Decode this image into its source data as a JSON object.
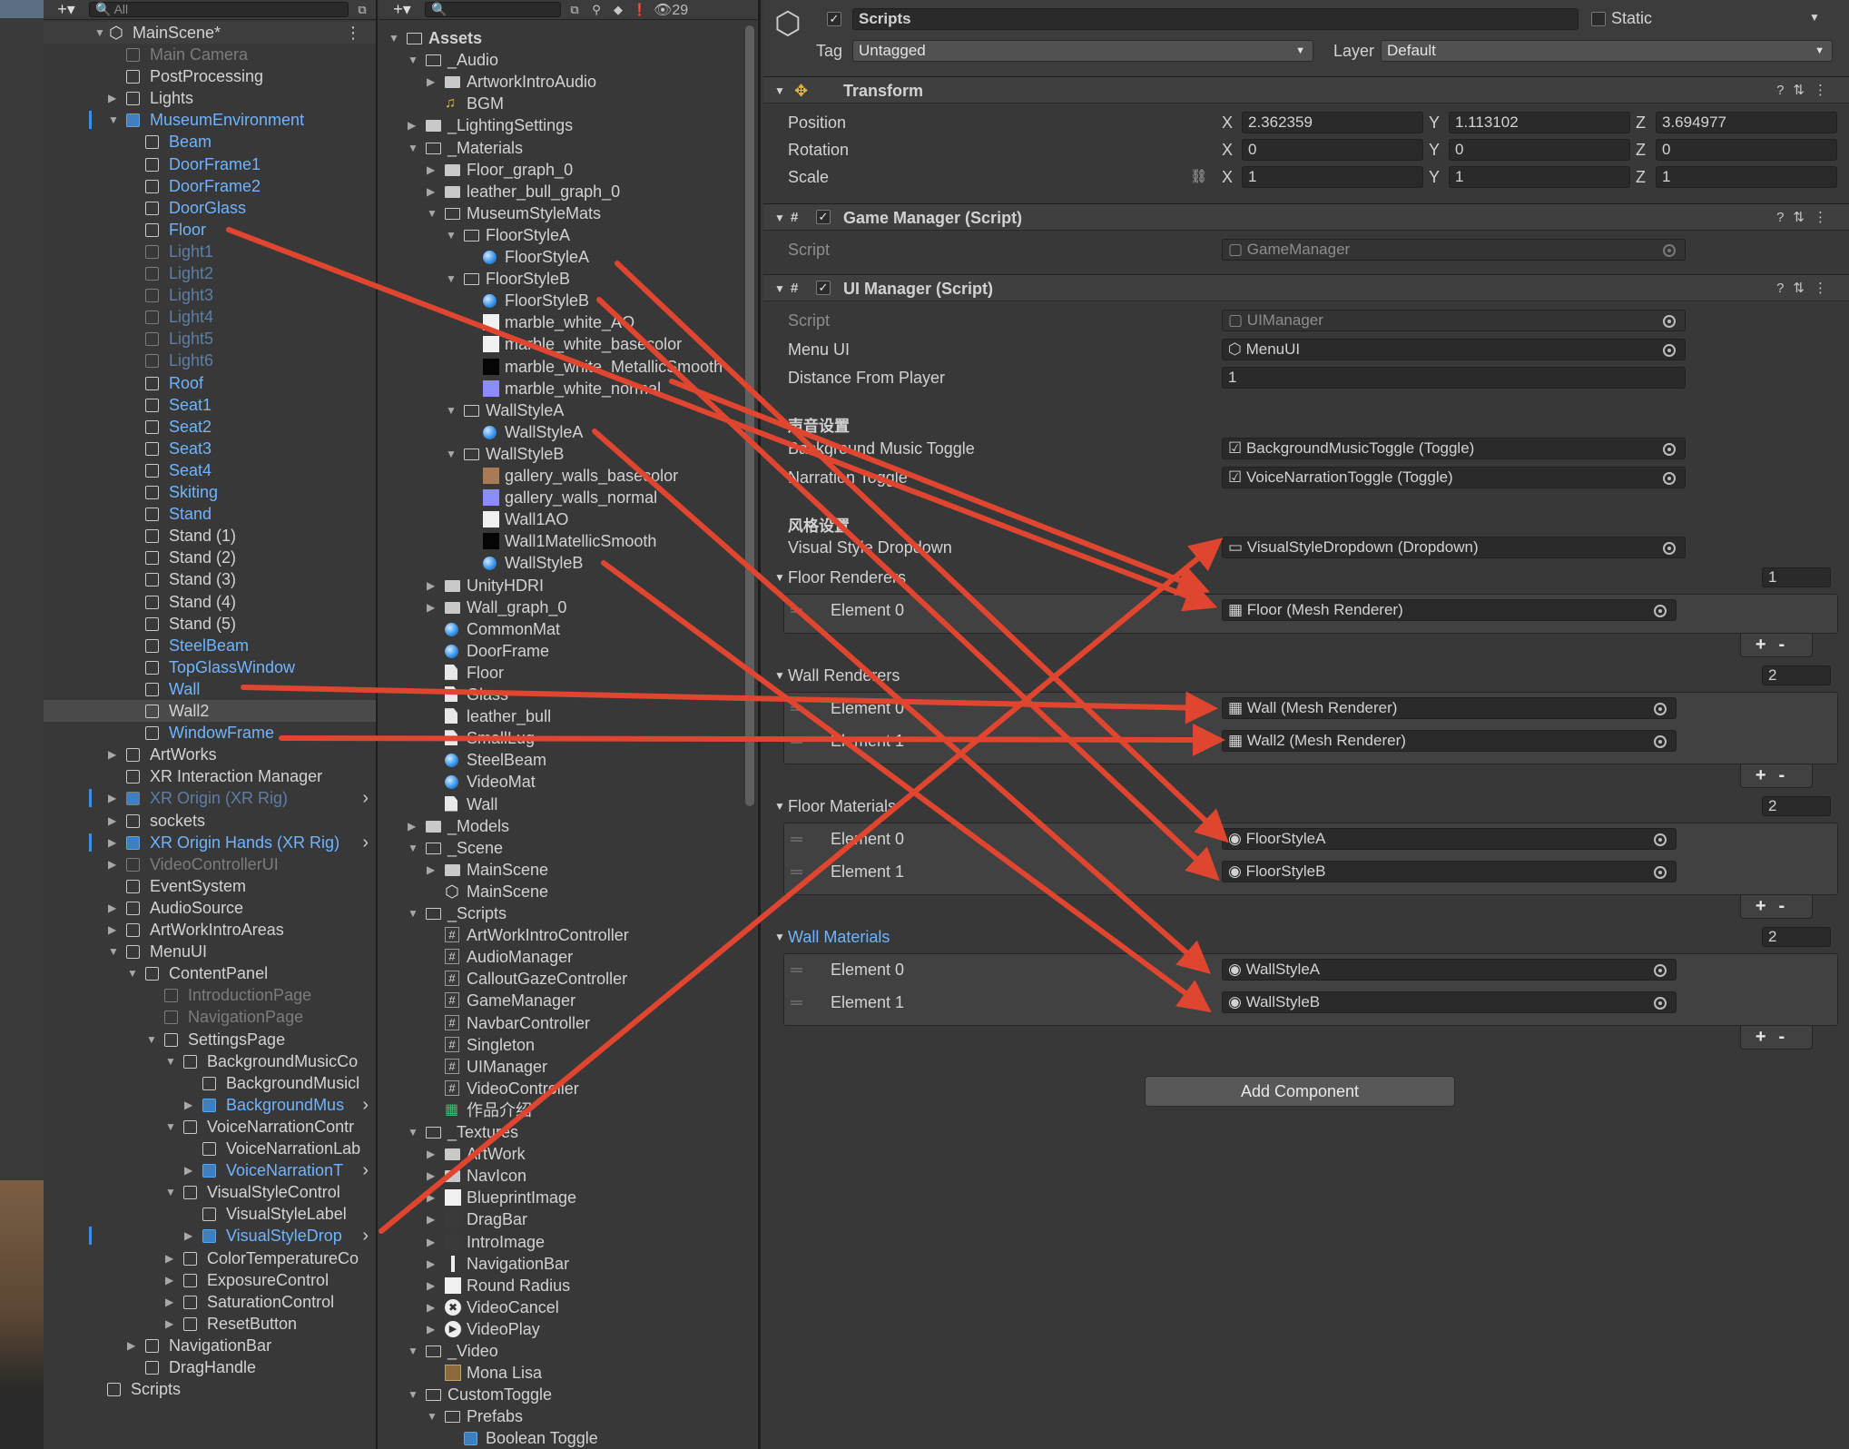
{
  "hierarchy": {
    "search_placeholder": "All",
    "scene_name": "MainScene*",
    "items": [
      {
        "label": "Main Camera",
        "state": "dim"
      },
      {
        "label": "PostProcessing",
        "state": "normal"
      },
      {
        "label": "Lights",
        "state": "normal"
      },
      {
        "label": "MuseumEnvironment",
        "state": "prefab"
      },
      {
        "label": "Beam",
        "state": "blue"
      },
      {
        "label": "DoorFrame1",
        "state": "blue"
      },
      {
        "label": "DoorFrame2",
        "state": "blue"
      },
      {
        "label": "DoorGlass",
        "state": "blue"
      },
      {
        "label": "Floor",
        "state": "blue"
      },
      {
        "label": "Light1",
        "state": "dimblue"
      },
      {
        "label": "Light2",
        "state": "dimblue"
      },
      {
        "label": "Light3",
        "state": "dimblue"
      },
      {
        "label": "Light4",
        "state": "dimblue"
      },
      {
        "label": "Light5",
        "state": "dimblue"
      },
      {
        "label": "Light6",
        "state": "dimblue"
      },
      {
        "label": "Roof",
        "state": "blue"
      },
      {
        "label": "Seat1",
        "state": "blue"
      },
      {
        "label": "Seat2",
        "state": "blue"
      },
      {
        "label": "Seat3",
        "state": "blue"
      },
      {
        "label": "Seat4",
        "state": "blue"
      },
      {
        "label": "Skiting",
        "state": "blue"
      },
      {
        "label": "Stand",
        "state": "blue"
      },
      {
        "label": "Stand (1)",
        "state": "normal"
      },
      {
        "label": "Stand (2)",
        "state": "normal"
      },
      {
        "label": "Stand (3)",
        "state": "normal"
      },
      {
        "label": "Stand (4)",
        "state": "normal"
      },
      {
        "label": "Stand (5)",
        "state": "normal"
      },
      {
        "label": "SteelBeam",
        "state": "blue"
      },
      {
        "label": "TopGlassWindow",
        "state": "blue"
      },
      {
        "label": "Wall",
        "state": "blue"
      },
      {
        "label": "Wall2",
        "state": "normal"
      },
      {
        "label": "WindowFrame",
        "state": "blue"
      },
      {
        "label": "ArtWorks",
        "state": "normal"
      },
      {
        "label": "XR Interaction Manager",
        "state": "normal"
      },
      {
        "label": "XR Origin (XR Rig)",
        "state": "prefabdim"
      },
      {
        "label": "sockets",
        "state": "normal"
      },
      {
        "label": "XR Origin Hands (XR Rig)",
        "state": "prefab"
      },
      {
        "label": "VideoControllerUI",
        "state": "dim"
      },
      {
        "label": "EventSystem",
        "state": "normal"
      },
      {
        "label": "AudioSource",
        "state": "normal"
      },
      {
        "label": "ArtWorkIntroAreas",
        "state": "normal"
      },
      {
        "label": "MenuUI",
        "state": "normal"
      },
      {
        "label": "ContentPanel",
        "state": "normal"
      },
      {
        "label": "IntroductionPage",
        "state": "dim"
      },
      {
        "label": "NavigationPage",
        "state": "dim"
      },
      {
        "label": "SettingsPage",
        "state": "normal"
      },
      {
        "label": "BackgroundMusicCo",
        "state": "normal"
      },
      {
        "label": "BackgroundMusicl",
        "state": "normal"
      },
      {
        "label": "BackgroundMus",
        "state": "prefab"
      },
      {
        "label": "VoiceNarrationContr",
        "state": "normal"
      },
      {
        "label": "VoiceNarrationLab",
        "state": "normal"
      },
      {
        "label": "VoiceNarrationT",
        "state": "prefab"
      },
      {
        "label": "VisualStyleControl",
        "state": "normal"
      },
      {
        "label": "VisualStyleLabel",
        "state": "normal"
      },
      {
        "label": "VisualStyleDrop",
        "state": "prefab"
      },
      {
        "label": "ColorTemperatureCo",
        "state": "normal"
      },
      {
        "label": "ExposureControl",
        "state": "normal"
      },
      {
        "label": "SaturationControl",
        "state": "normal"
      },
      {
        "label": "ResetButton",
        "state": "normal"
      },
      {
        "label": "NavigationBar",
        "state": "normal"
      },
      {
        "label": "DragHandle",
        "state": "normal"
      },
      {
        "label": "Scripts",
        "state": "normal"
      }
    ]
  },
  "project": {
    "visible_count": "29",
    "items": [
      {
        "label": "Assets",
        "kind": "folder"
      },
      {
        "label": "_Audio",
        "kind": "folder"
      },
      {
        "label": "ArtworkIntroAudio",
        "kind": "folder"
      },
      {
        "label": "BGM",
        "kind": "audio"
      },
      {
        "label": "_LightingSettings",
        "kind": "folder"
      },
      {
        "label": "_Materials",
        "kind": "folder"
      },
      {
        "label": "Floor_graph_0",
        "kind": "folder"
      },
      {
        "label": "leather_bull_graph_0",
        "kind": "folder"
      },
      {
        "label": "MuseumStyleMats",
        "kind": "folder"
      },
      {
        "label": "FloorStyleA",
        "kind": "folder"
      },
      {
        "label": "FloorStyleA",
        "kind": "material"
      },
      {
        "label": "FloorStyleB",
        "kind": "folder"
      },
      {
        "label": "FloorStyleB",
        "kind": "material"
      },
      {
        "label": "marble_white_AO",
        "kind": "tex-white"
      },
      {
        "label": "marble_white_basecolor",
        "kind": "tex-white"
      },
      {
        "label": "marble_white_MetallicSmooth",
        "kind": "tex-black"
      },
      {
        "label": "marble_white_normal",
        "kind": "tex-normal"
      },
      {
        "label": "WallStyleA",
        "kind": "folder"
      },
      {
        "label": "WallStyleA",
        "kind": "material"
      },
      {
        "label": "WallStyleB",
        "kind": "folder"
      },
      {
        "label": "gallery_walls_basecolor",
        "kind": "tex-brown"
      },
      {
        "label": "gallery_walls_normal",
        "kind": "tex-normal"
      },
      {
        "label": "Wall1AO",
        "kind": "tex-white"
      },
      {
        "label": "Wall1MatellicSmooth",
        "kind": "tex-black"
      },
      {
        "label": "WallStyleB",
        "kind": "material"
      },
      {
        "label": "UnityHDRI",
        "kind": "folder"
      },
      {
        "label": "Wall_graph_0",
        "kind": "folder"
      },
      {
        "label": "CommonMat",
        "kind": "material"
      },
      {
        "label": "DoorFrame",
        "kind": "material"
      },
      {
        "label": "Floor",
        "kind": "file"
      },
      {
        "label": "Glass",
        "kind": "file"
      },
      {
        "label": "leather_bull",
        "kind": "file"
      },
      {
        "label": "SmallLug",
        "kind": "file"
      },
      {
        "label": "SteelBeam",
        "kind": "material"
      },
      {
        "label": "VideoMat",
        "kind": "material"
      },
      {
        "label": "Wall",
        "kind": "file"
      },
      {
        "label": "_Models",
        "kind": "folder"
      },
      {
        "label": "_Scene",
        "kind": "folder"
      },
      {
        "label": "MainScene",
        "kind": "folder"
      },
      {
        "label": "MainScene",
        "kind": "scene"
      },
      {
        "label": "_Scripts",
        "kind": "folder"
      },
      {
        "label": "ArtWorkIntroController",
        "kind": "script"
      },
      {
        "label": "AudioManager",
        "kind": "script"
      },
      {
        "label": "CalloutGazeController",
        "kind": "script"
      },
      {
        "label": "GameManager",
        "kind": "script"
      },
      {
        "label": "NavbarController",
        "kind": "script"
      },
      {
        "label": "Singleton",
        "kind": "script"
      },
      {
        "label": "UIManager",
        "kind": "script"
      },
      {
        "label": "VideoController",
        "kind": "script"
      },
      {
        "label": "作品介绍",
        "kind": "sheet"
      },
      {
        "label": "_Textures",
        "kind": "folder"
      },
      {
        "label": "ArtWork",
        "kind": "folder"
      },
      {
        "label": "NavIcon",
        "kind": "folder"
      },
      {
        "label": "BlueprintImage",
        "kind": "tex-white"
      },
      {
        "label": "DragBar",
        "kind": "tex-dark"
      },
      {
        "label": "IntroImage",
        "kind": "tex-dark"
      },
      {
        "label": "NavigationBar",
        "kind": "tex-bar"
      },
      {
        "label": "Round Radius",
        "kind": "tex-white"
      },
      {
        "label": "VideoCancel",
        "kind": "tex-x"
      },
      {
        "label": "VideoPlay",
        "kind": "tex-play"
      },
      {
        "label": "_Video",
        "kind": "folder"
      },
      {
        "label": "Mona Lisa",
        "kind": "video"
      },
      {
        "label": "CustomToggle",
        "kind": "folder"
      },
      {
        "label": "Prefabs",
        "kind": "folder"
      },
      {
        "label": "Boolean Toggle",
        "kind": "prefab"
      }
    ]
  },
  "inspector": {
    "object_name": "Scripts",
    "static_label": "Static",
    "tag_label": "Tag",
    "tag_value": "Untagged",
    "layer_label": "Layer",
    "layer_value": "Default",
    "transform": {
      "title": "Transform",
      "position_label": "Position",
      "rotation_label": "Rotation",
      "scale_label": "Scale",
      "position": {
        "x": "2.362359",
        "y": "1.113102",
        "z": "3.694977"
      },
      "rotation": {
        "x": "0",
        "y": "0",
        "z": "0"
      },
      "scale": {
        "x": "1",
        "y": "1",
        "z": "1"
      },
      "axis_x": "X",
      "axis_y": "Y",
      "axis_z": "Z"
    },
    "game_manager": {
      "title": "Game Manager (Script)",
      "script_label": "Script",
      "script_value": "GameManager"
    },
    "ui_manager": {
      "title": "UI Manager (Script)",
      "script_label": "Script",
      "script_value": "UIManager",
      "menu_ui_label": "Menu UI",
      "menu_ui_value": "MenuUI",
      "distance_label": "Distance From Player",
      "distance_value": "1",
      "audio_section": "声音设置",
      "bg_music_label": "Background Music Toggle",
      "bg_music_value": "BackgroundMusicToggle (Toggle)",
      "narration_label": "Narration Toggle",
      "narration_value": "VoiceNarrationToggle (Toggle)",
      "style_section": "风格设置",
      "visual_style_label": "Visual Style Dropdown",
      "visual_style_value": "VisualStyleDropdown (Dropdown)",
      "floor_renderers_label": "Floor Renderers",
      "floor_renderers_count": "1",
      "floor_renderers": [
        {
          "label": "Element 0",
          "value": "Floor (Mesh Renderer)"
        }
      ],
      "wall_renderers_label": "Wall Renderers",
      "wall_renderers_count": "2",
      "wall_renderers": [
        {
          "label": "Element 0",
          "value": "Wall (Mesh Renderer)"
        },
        {
          "label": "Element 1",
          "value": "Wall2 (Mesh Renderer)"
        }
      ],
      "floor_materials_label": "Floor Materials",
      "floor_materials_count": "2",
      "floor_materials": [
        {
          "label": "Element 0",
          "value": "FloorStyleA"
        },
        {
          "label": "Element 1",
          "value": "FloorStyleB"
        }
      ],
      "wall_materials_label": "Wall Materials",
      "wall_materials_count": "2",
      "wall_materials": [
        {
          "label": "Element 0",
          "value": "WallStyleA"
        },
        {
          "label": "Element 1",
          "value": "WallStyleB"
        }
      ]
    },
    "add_component": "Add Component",
    "plus_minus": "+-"
  },
  "colors": {
    "annotation_arrow": "#e0452f",
    "prefab_blue": "#6fb4ff",
    "selection": "#4a4a4a"
  }
}
